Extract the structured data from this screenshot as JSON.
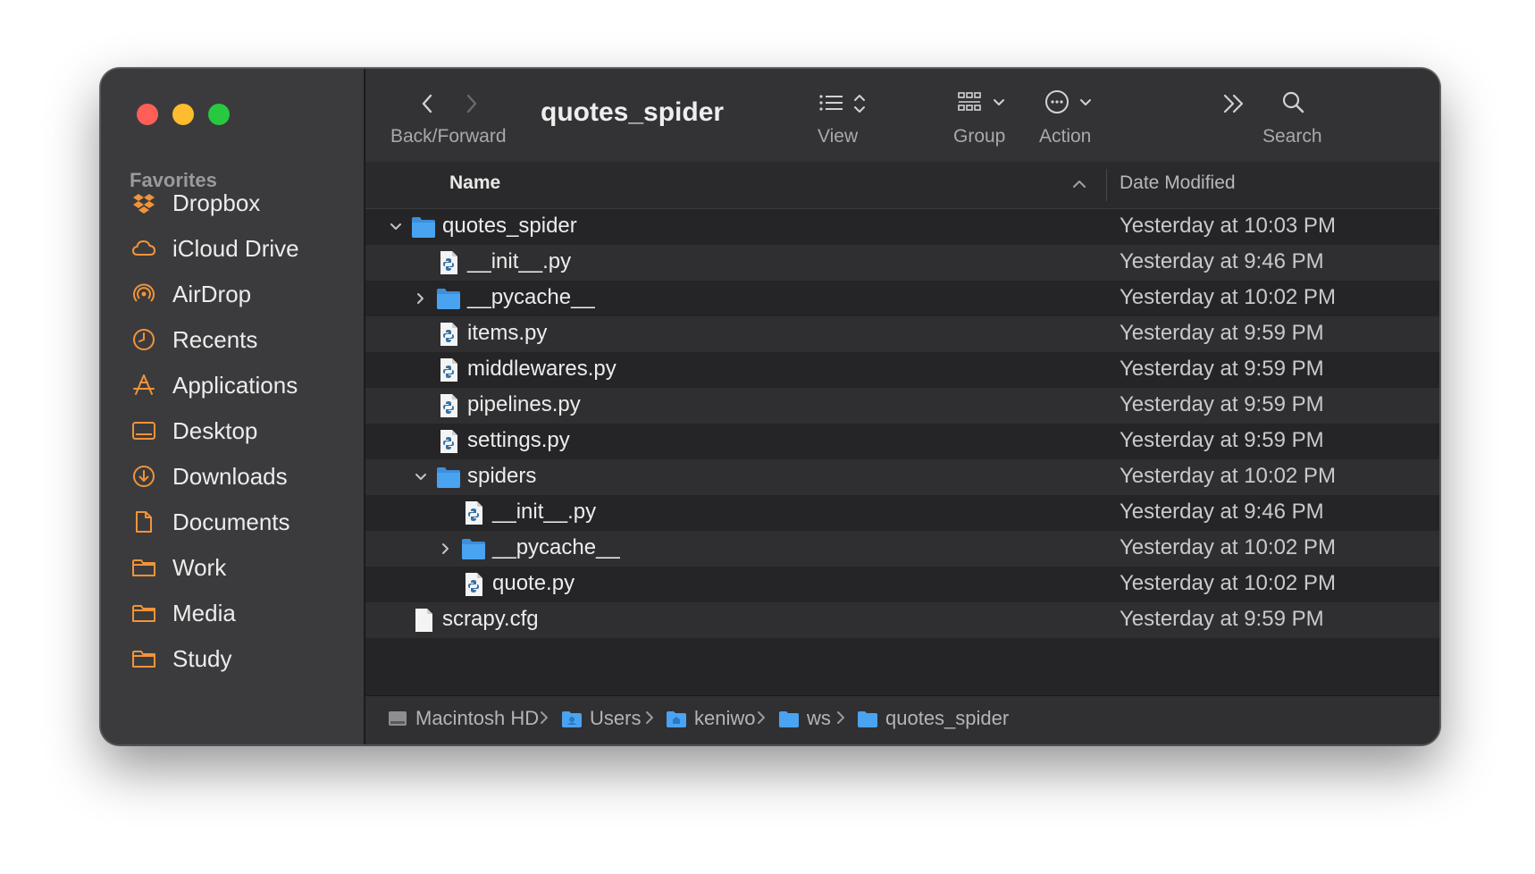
{
  "window": {
    "title": "quotes_spider"
  },
  "sidebar": {
    "header": "Favorites",
    "items": [
      {
        "label": "Dropbox",
        "icon": "dropbox-icon"
      },
      {
        "label": "iCloud Drive",
        "icon": "cloud-icon"
      },
      {
        "label": "AirDrop",
        "icon": "airdrop-icon"
      },
      {
        "label": "Recents",
        "icon": "clock-icon"
      },
      {
        "label": "Applications",
        "icon": "applications-icon"
      },
      {
        "label": "Desktop",
        "icon": "desktop-icon"
      },
      {
        "label": "Downloads",
        "icon": "download-icon"
      },
      {
        "label": "Documents",
        "icon": "document-icon"
      },
      {
        "label": "Work",
        "icon": "folder-icon"
      },
      {
        "label": "Media",
        "icon": "folder-icon"
      },
      {
        "label": "Study",
        "icon": "folder-icon"
      }
    ],
    "accent_color": "#f0943a"
  },
  "toolbar": {
    "back_forward_label": "Back/Forward",
    "view_label": "View",
    "group_label": "Group",
    "action_label": "Action",
    "search_label": "Search"
  },
  "columns": {
    "name": "Name",
    "date": "Date Modified"
  },
  "files": [
    {
      "name": "quotes_spider",
      "date": "Yesterday at 10:03 PM",
      "type": "folder",
      "expanded": true
    },
    {
      "name": "__init__.py",
      "date": "Yesterday at 9:46 PM",
      "type": "python"
    },
    {
      "name": "__pycache__",
      "date": "Yesterday at 10:02 PM",
      "type": "folder",
      "expanded": false
    },
    {
      "name": "items.py",
      "date": "Yesterday at 9:59 PM",
      "type": "python"
    },
    {
      "name": "middlewares.py",
      "date": "Yesterday at 9:59 PM",
      "type": "python"
    },
    {
      "name": "pipelines.py",
      "date": "Yesterday at 9:59 PM",
      "type": "python"
    },
    {
      "name": "settings.py",
      "date": "Yesterday at 9:59 PM",
      "type": "python"
    },
    {
      "name": "spiders",
      "date": "Yesterday at 10:02 PM",
      "type": "folder",
      "expanded": true
    },
    {
      "name": "__init__.py",
      "date": "Yesterday at 9:46 PM",
      "type": "python"
    },
    {
      "name": "__pycache__",
      "date": "Yesterday at 10:02 PM",
      "type": "folder",
      "expanded": false
    },
    {
      "name": "quote.py",
      "date": "Yesterday at 10:02 PM",
      "type": "python"
    },
    {
      "name": "scrapy.cfg",
      "date": "Yesterday at 9:59 PM",
      "type": "document"
    }
  ],
  "path": [
    {
      "label": "Macintosh HD",
      "icon": "hard-drive-icon"
    },
    {
      "label": "Users",
      "icon": "users-folder-icon"
    },
    {
      "label": "keniwo",
      "icon": "home-folder-icon"
    },
    {
      "label": "ws",
      "icon": "folder-icon"
    },
    {
      "label": "quotes_spider",
      "icon": "folder-icon"
    }
  ],
  "colors": {
    "folder_blue": "#4aa3f0",
    "traffic_red": "#ff5f57",
    "traffic_yellow": "#febc2e",
    "traffic_green": "#28c840"
  }
}
